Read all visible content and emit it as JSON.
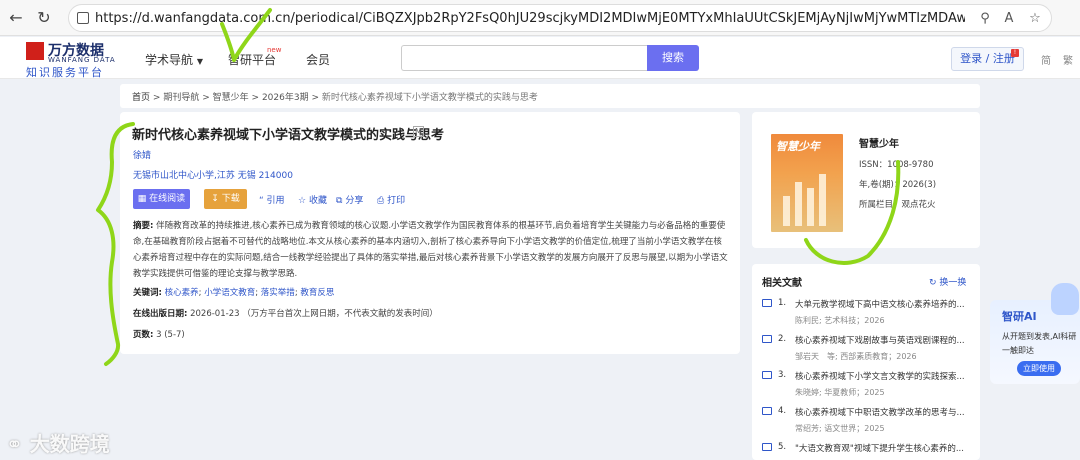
{
  "browser": {
    "url": "https://d.wanfangdata.com.cn/periodical/CiBQZXJpb2RpY2FsQ0hJU29scjkyMDI2MDIwMjE0MTYxMhIaUUtCSkJEMjAyNjIwMjYwMTIzMDAwMDMxNjEaCDRh..."
  },
  "header": {
    "logo_name": "万方数据",
    "logo_en": "WANFANG DATA",
    "logo_sub": "知识服务平台",
    "nav": [
      "学术导航",
      "智研平台",
      "会员"
    ],
    "nav_new": "new",
    "search_button": "搜索",
    "login": "登录 / 注册",
    "lang": [
      "简",
      "繁"
    ]
  },
  "breadcrumb": {
    "items": [
      "首页",
      "期刊导航",
      "智慧少年",
      "2026年3期"
    ],
    "current": "新时代核心素养视域下小学语文教学模式的实践与思考",
    "sep": ">"
  },
  "article": {
    "title": "新时代核心素养视域下小学语文教学模式的实践与思考",
    "badge": "M",
    "author": "徐婧",
    "org": "无锡市山北中心小学,江苏 无锡 214000",
    "btn_read": "在线阅读",
    "btn_download": "下载",
    "actions": [
      "引用",
      "收藏",
      "分享",
      "打印"
    ],
    "abstract_label": "摘要:",
    "abstract": "伴随教育改革的持续推进,核心素养已成为教育领域的核心议题.小学语文教学作为国民教育体系的根基环节,肩负着培育学生关键能力与必备品格的重要使命,在基础教育阶段占据着不可替代的战略地位.本文从核心素养的基本内涵切入,剖析了核心素养导向下小学语文教学的价值定位,梳理了当前小学语文教学在核心素养培育过程中存在的实际问题,结合一线教学经验提出了具体的落实举措,最后对核心素养背景下小学语文教学的发展方向展开了反思与展望,以期为小学语文教学实践提供可借鉴的理论支撑与教学思路.",
    "keywords_label": "关键词:",
    "keywords": [
      "核心素养",
      "小学语文教育",
      "落实举措",
      "教育反思"
    ],
    "pubdate_label": "在线出版日期:",
    "pubdate": "2026-01-23  （万方平台首次上网日期，不代表文献的发表时间）",
    "pages_label": "页数:",
    "pages": "3 (5-7)"
  },
  "journal": {
    "cover_title": "智慧少年",
    "name": "智慧少年",
    "issn": "ISSN：1008-9780",
    "year": "年,卷(期)：2026(3)",
    "column": "所属栏目：观点花火"
  },
  "related": {
    "title": "相关文献",
    "switch": "换一换",
    "items": [
      {
        "num": "1.",
        "title": "大单元教学视域下高中语文核心素养培养的...",
        "meta": "陈利民; 艺术科技；2026"
      },
      {
        "num": "2.",
        "title": "核心素养视域下戏剧故事与英语戏剧课程的...",
        "meta": "邹岩天　等; 西部素质教育；2026"
      },
      {
        "num": "3.",
        "title": "核心素养视域下小学文言文教学的实践探索...",
        "meta": "朱晓婷; 华夏教师；2025"
      },
      {
        "num": "4.",
        "title": "核心素养视域下中职语文教学改革的思考与...",
        "meta": "常绍芳; 语文世界；2025"
      },
      {
        "num": "5.",
        "title": "\"大语文教育观\"视域下提升学生核心素养的...",
        "meta": ""
      }
    ]
  },
  "ai_promo": {
    "title": "智研AI",
    "desc": "从开题到发表,AI科研一触即达",
    "button": "立即使用"
  },
  "watermark": "大数跨境"
}
